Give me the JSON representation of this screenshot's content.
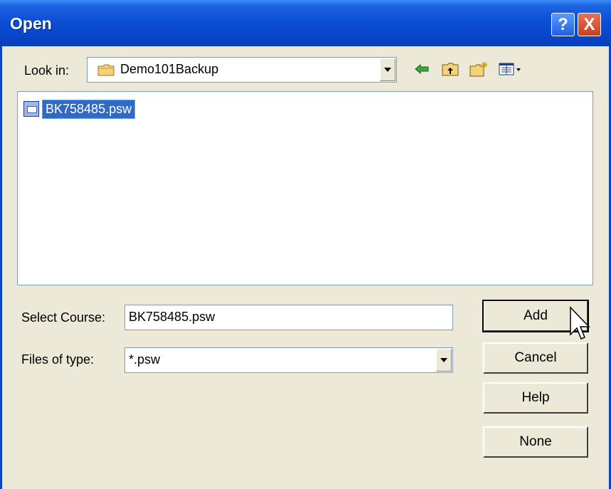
{
  "window": {
    "title": "Open",
    "help_label": "?",
    "close_label": "X"
  },
  "look_in": {
    "label": "Look in:",
    "value": "Demo101Backup",
    "icon": "folder-icon"
  },
  "toolbar": {
    "icons": [
      "back-arrow-icon",
      "up-folder-icon",
      "new-folder-icon",
      "view-menu-icon"
    ]
  },
  "file_list": {
    "items": [
      {
        "name": "BK758485.psw",
        "selected": true,
        "icon": "file-icon"
      }
    ]
  },
  "select_course": {
    "label": "Select Course:",
    "value": "BK758485.psw"
  },
  "files_of_type": {
    "label": "Files of type:",
    "value": "*.psw"
  },
  "buttons": {
    "add": "Add",
    "cancel": "Cancel",
    "help": "Help",
    "none": "None"
  },
  "colors": {
    "titlebar": "#0a4fd6",
    "dialog_bg": "#ece9d8",
    "selection": "#316ac5"
  }
}
